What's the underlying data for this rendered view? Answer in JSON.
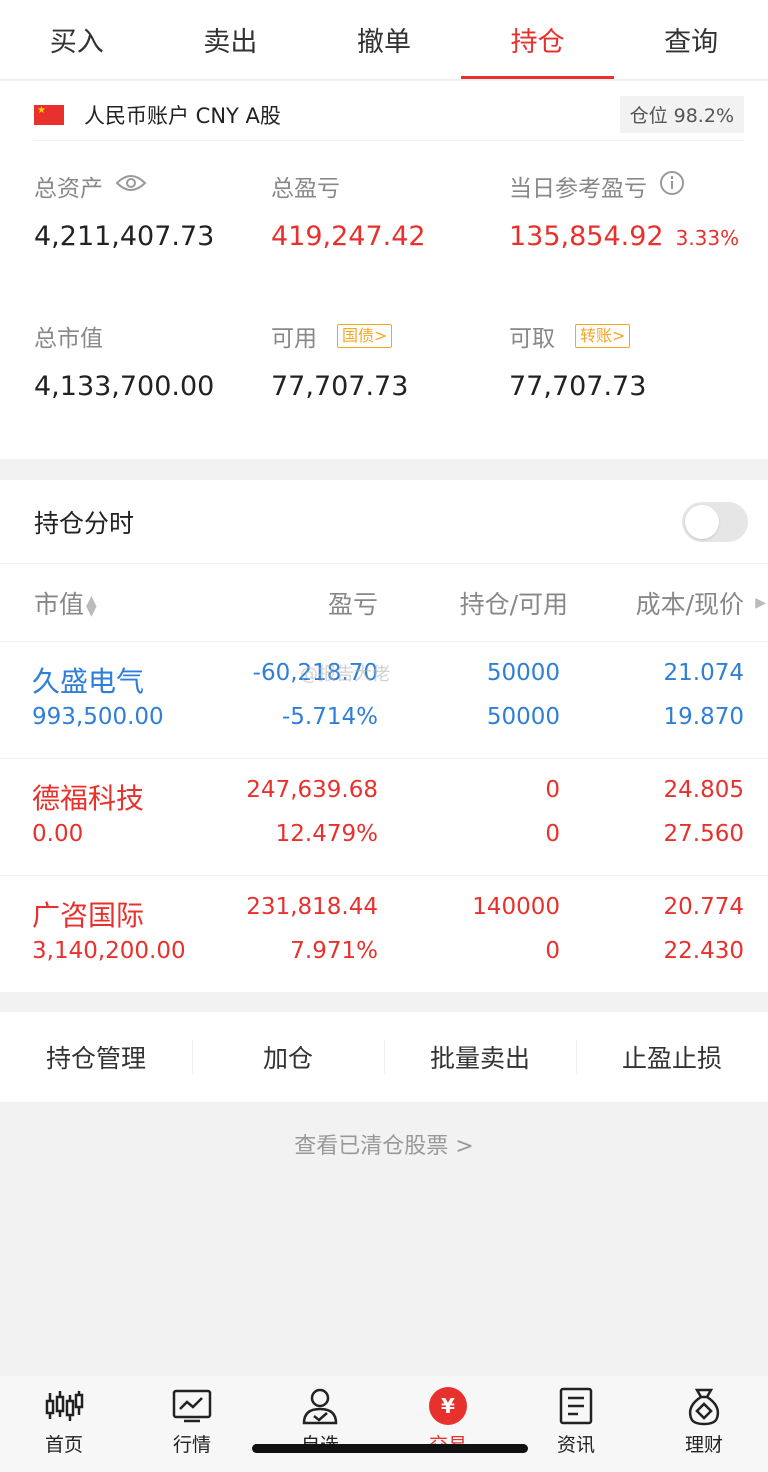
{
  "tabs": [
    {
      "label": "买入",
      "active": false
    },
    {
      "label": "卖出",
      "active": false
    },
    {
      "label": "撤单",
      "active": false
    },
    {
      "label": "持仓",
      "active": true
    },
    {
      "label": "查询",
      "active": false
    }
  ],
  "account": {
    "name": "人民币账户 CNY A股",
    "position_ratio": "仓位 98.2%"
  },
  "metrics": {
    "total_assets": {
      "label": "总资产",
      "value": "4,211,407.73"
    },
    "total_pl": {
      "label": "总盈亏",
      "value": "419,247.42"
    },
    "daily_pl": {
      "label": "当日参考盈亏",
      "value": "135,854.92",
      "pct": "3.33%"
    },
    "market_value": {
      "label": "总市值",
      "value": "4,133,700.00"
    },
    "available": {
      "label": "可用",
      "chip": "国债>",
      "value": "77,707.73"
    },
    "withdrawable": {
      "label": "可取",
      "chip": "转账>",
      "value": "77,707.73"
    }
  },
  "holdings": {
    "title": "持仓分时",
    "toggle_on": false,
    "columns": {
      "market_value": "市值",
      "pl": "盈亏",
      "qty": "持仓/可用",
      "price": "成本/现价"
    },
    "watermark": "@报告大佬",
    "rows": [
      {
        "name": "久盛电气",
        "market_value": "993,500.00",
        "pl": "-60,218.70",
        "pl_pct": "-5.714%",
        "qty": "50000",
        "avail": "50000",
        "cost": "21.074",
        "price": "19.870",
        "tone": "blue"
      },
      {
        "name": "德福科技",
        "market_value": "0.00",
        "pl": "247,639.68",
        "pl_pct": "12.479%",
        "qty": "0",
        "avail": "0",
        "cost": "24.805",
        "price": "27.560",
        "tone": "red"
      },
      {
        "name": "广咨国际",
        "market_value": "3,140,200.00",
        "pl": "231,818.44",
        "pl_pct": "7.971%",
        "qty": "140000",
        "avail": "0",
        "cost": "20.774",
        "price": "22.430",
        "tone": "red"
      }
    ]
  },
  "actions": [
    "持仓管理",
    "加仓",
    "批量卖出",
    "止盈止损"
  ],
  "cleared_link": "查看已清仓股票 >",
  "bottom_nav": [
    {
      "label": "首页",
      "icon": "candlestick-icon"
    },
    {
      "label": "行情",
      "icon": "chart-icon"
    },
    {
      "label": "自选",
      "icon": "user-check-icon"
    },
    {
      "label": "交易",
      "icon": "yuan-icon",
      "active": true
    },
    {
      "label": "资讯",
      "icon": "document-icon"
    },
    {
      "label": "理财",
      "icon": "money-bag-icon"
    }
  ],
  "colors": {
    "up": "#e8312c",
    "down": "#2f7fd8",
    "chip": "#f5a623"
  }
}
